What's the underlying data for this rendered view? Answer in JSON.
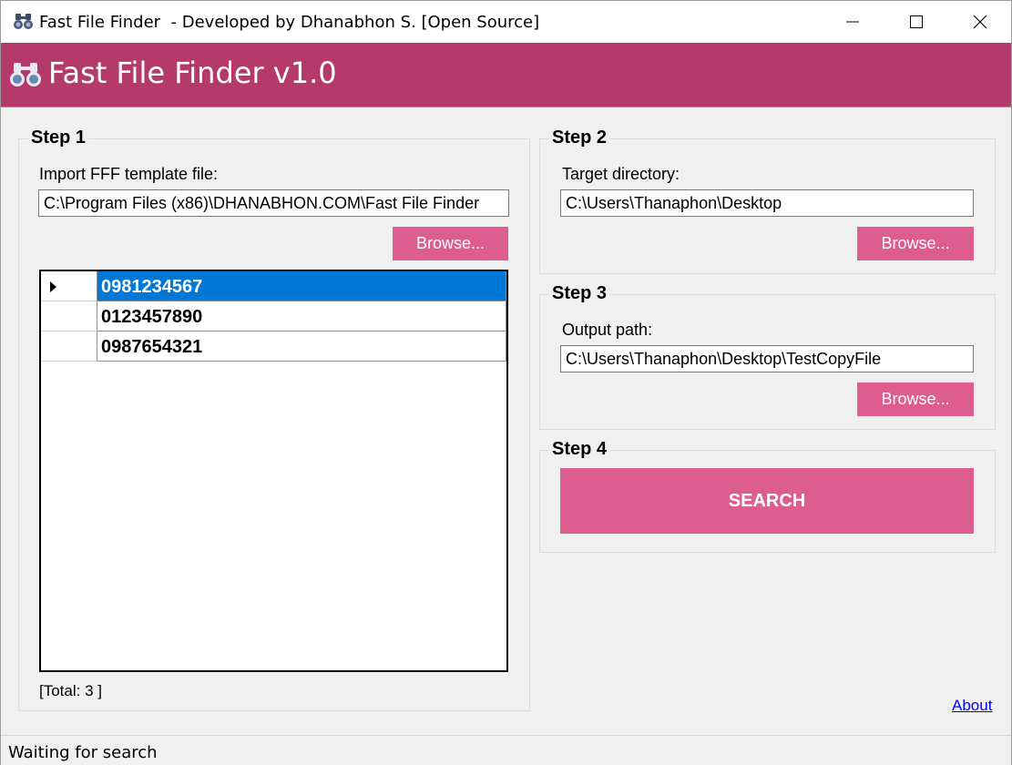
{
  "window": {
    "title": "Fast File Finder  - Developed by Dhanabhon S. [Open Source]",
    "icon": "binoculars-icon"
  },
  "banner": {
    "title": "Fast File Finder v1.0",
    "color": "#b33a69"
  },
  "step1": {
    "label": "Step 1",
    "field_label": "Import FFF template file:",
    "path_value": "C:\\Program Files (x86)\\DHANABHON.COM\\Fast File Finder",
    "browse_label": "Browse...",
    "rows": [
      "0981234567",
      "0123457890",
      "0987654321"
    ],
    "selected_row": 0,
    "total_text": "[Total: 3 ]"
  },
  "step2": {
    "label": "Step 2",
    "field_label": "Target directory:",
    "path_value": "C:\\Users\\Thanaphon\\Desktop",
    "browse_label": "Browse..."
  },
  "step3": {
    "label": "Step 3",
    "field_label": "Output path:",
    "path_value": "C:\\Users\\Thanaphon\\Desktop\\TestCopyFile",
    "browse_label": "Browse..."
  },
  "step4": {
    "label": "Step 4",
    "search_label": "SEARCH"
  },
  "about_link": "About",
  "status": "Waiting for search",
  "colors": {
    "accent": "#de5d8f",
    "selection": "#0078d7"
  }
}
